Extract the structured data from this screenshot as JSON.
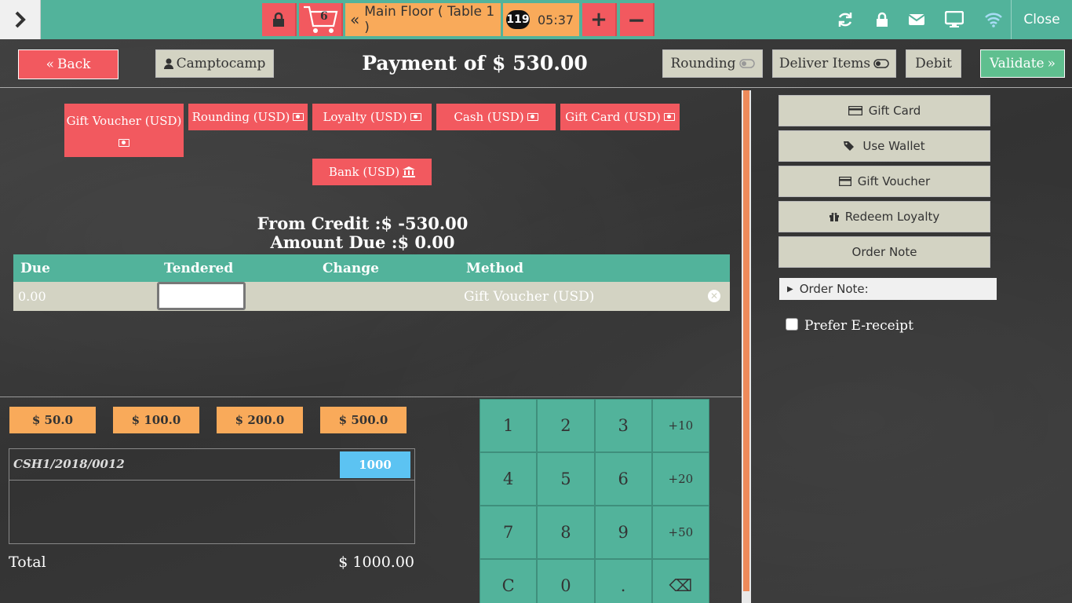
{
  "topbar": {
    "cart_count": "6",
    "floor_label": "Main Floor ( Table 1 )",
    "timer_badge": "119",
    "timer_time": "05:37",
    "plus_label": "+",
    "minus_label": "−",
    "close_label": "Close",
    "accent_color": "#52b39b"
  },
  "header": {
    "back_label": "Back",
    "customer_label": "Camptocamp",
    "payment_title": "Payment of $ 530.00",
    "rounding_label": "Rounding",
    "deliver_label": "Deliver Items",
    "debit_label": "Debit",
    "validate_label": "Validate"
  },
  "payment_methods": {
    "gift_voucher": "Gift Voucher (USD)",
    "rounding": "Rounding (USD)",
    "loyalty": "Loyalty (USD)",
    "cash": "Cash (USD)",
    "gift_card": "Gift Card (USD)",
    "bank": "Bank (USD)"
  },
  "summary": {
    "from_credit": "From Credit :$ -530.00",
    "amount_due": "Amount Due :$ 0.00"
  },
  "payment_table": {
    "headers": [
      "Due",
      "Tendered",
      "Change",
      "Method"
    ],
    "row": {
      "due": "0.00",
      "tendered": "",
      "change": "",
      "method": "Gift Voucher (USD)"
    }
  },
  "quick_cash": [
    "$ 50.0",
    "$ 100.0",
    "$ 200.0",
    "$ 500.0"
  ],
  "cash_box": {
    "reference": "CSH1/2018/0012",
    "value": "1000",
    "total_label": "Total",
    "total_value": "$ 1000.00"
  },
  "numpad": {
    "keys": [
      "1",
      "2",
      "3",
      "+10",
      "4",
      "5",
      "6",
      "+20",
      "7",
      "8",
      "9",
      "+50",
      "C",
      "0",
      ".",
      "⌫"
    ]
  },
  "right_panel": {
    "gift_card": "Gift Card",
    "use_wallet": "Use Wallet",
    "gift_voucher": "Gift Voucher",
    "redeem_loyalty": "Redeem Loyalty",
    "order_note": "Order Note",
    "order_note_field": "Order Note:",
    "ereceipt_label": "Prefer E-receipt"
  }
}
